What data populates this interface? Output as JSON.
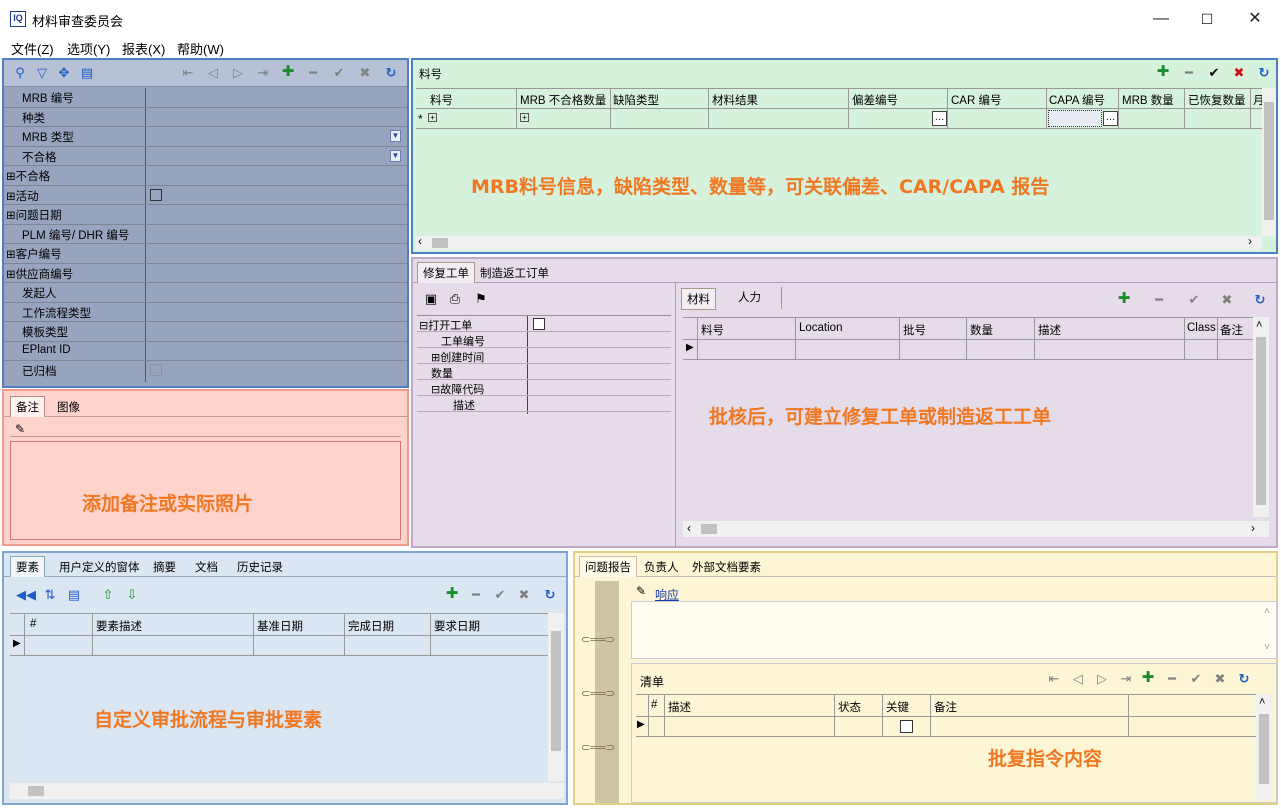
{
  "window": {
    "title": "材料审查委员会",
    "logo_text": "IQ",
    "minimize": "—",
    "maximize": "☐",
    "close": "✕"
  },
  "menu": [
    {
      "label": "文件(Z)"
    },
    {
      "label": "选项(Y)"
    },
    {
      "label": "报表(X)"
    },
    {
      "label": "帮助(W)"
    }
  ],
  "props": {
    "rows": [
      {
        "label": "MRB 编号"
      },
      {
        "label": "种类"
      },
      {
        "label": "MRB 类型"
      },
      {
        "label": "不合格"
      },
      {
        "label": "⊞不合格"
      },
      {
        "label": "⊞活动"
      },
      {
        "label": "⊞问题日期"
      },
      {
        "label": "PLM 编号/ DHR 编号"
      },
      {
        "label": "⊞客户编号"
      },
      {
        "label": "⊞供应商编号"
      },
      {
        "label": "发起人"
      },
      {
        "label": "工作流程类型"
      },
      {
        "label": "模板类型"
      },
      {
        "label": "EPlant ID"
      },
      {
        "label": "已归档"
      }
    ]
  },
  "notes": {
    "tabs": [
      "备注",
      "图像"
    ],
    "annotation": "添加备注或实际照片"
  },
  "items": {
    "title": "料号",
    "columns": [
      "料号",
      "MRB 不合格数量",
      "缺陷类型",
      "材料结果",
      "偏差编号",
      "CAR 编号",
      "CAPA 编号",
      "MRB 数量",
      "已恢复数量",
      "月"
    ],
    "row_marker": "*",
    "annotation": "MRB料号信息，缺陷类型、数量等，可关联偏差、CAR/CAPA 报告"
  },
  "repair": {
    "tabs": [
      "修复工单",
      "制造返工订单"
    ],
    "tree": [
      "⊟打开工单",
      "工单编号",
      "⊞创建时间",
      "数量",
      "⊟故障代码",
      "描述"
    ],
    "subtabs": [
      "材料",
      "人力"
    ],
    "columns": [
      "料号",
      "Location",
      "批号",
      "数量",
      "描述",
      "Class",
      "备注"
    ],
    "annotation": "批核后，可建立修复工单或制造返工工单"
  },
  "elements": {
    "tabs": [
      "要素",
      "用户定义的窗体",
      "摘要",
      "文档",
      "历史记录"
    ],
    "columns": [
      "#",
      "要素描述",
      "基准日期",
      "完成日期",
      "要求日期"
    ],
    "annotation": "自定义审批流程与审批要素"
  },
  "report": {
    "tabs": [
      "问题报告",
      "负责人",
      "外部文档要素"
    ],
    "response_link": "响应",
    "checklist_title": "清单",
    "columns": [
      "#",
      "描述",
      "状态",
      "关键",
      "备注"
    ],
    "annotation": "批复指令内容"
  }
}
